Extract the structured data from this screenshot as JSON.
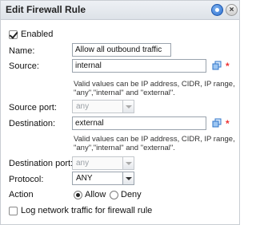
{
  "dialog": {
    "title": "Edit Firewall Rule"
  },
  "form": {
    "enabled_label": "Enabled",
    "name_label": "Name:",
    "name_value": "Allow all outbound traffic",
    "source_label": "Source:",
    "source_value": "internal",
    "source_hint_line1": "Valid values can be IP address, CIDR, IP range,",
    "source_hint_line2": "\"any\",\"internal\" and \"external\".",
    "source_port_label": "Source port:",
    "source_port_value": "any",
    "destination_label": "Destination:",
    "destination_value": "external",
    "destination_hint_line1": "Valid values can be IP address, CIDR, IP range,",
    "destination_hint_line2": "\"any\",\"internal\" and \"external\".",
    "destination_port_label": "Destination port:",
    "destination_port_value": "any",
    "protocol_label": "Protocol:",
    "protocol_value": "ANY",
    "action_label": "Action",
    "action_allow": "Allow",
    "action_deny": "Deny",
    "log_label": "Log network traffic for firewall rule",
    "required_marker": "*"
  }
}
